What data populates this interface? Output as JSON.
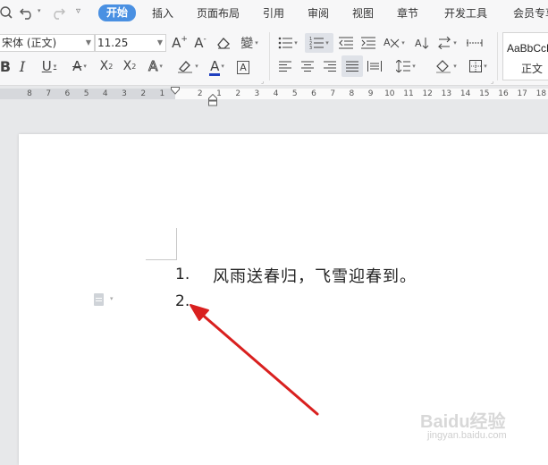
{
  "menubar": {
    "tabs": [
      "开始",
      "插入",
      "页面布局",
      "引用",
      "审阅",
      "视图",
      "章节",
      "开发工具",
      "会员专享"
    ],
    "active_tab": "开始"
  },
  "ribbon": {
    "font_name": "宋体 (正文)",
    "font_size": "11.25",
    "style_sample": "AaBbCcDd",
    "style_name": "正文"
  },
  "ruler": {
    "labels": [
      "8",
      "7",
      "6",
      "5",
      "4",
      "3",
      "2",
      "1",
      "",
      "2",
      "1",
      "2",
      "3",
      "4",
      "5",
      "6",
      "7",
      "8",
      "9",
      "10",
      "11",
      "12",
      "13",
      "14",
      "15",
      "16",
      "17",
      "18"
    ]
  },
  "document": {
    "list": [
      {
        "number": "1.",
        "text": "风雨送春归，飞雪迎春到。"
      },
      {
        "number": "2.",
        "text": ""
      }
    ]
  },
  "watermark": {
    "brand": "Baidu经验",
    "url": "jingyan.baidu.com"
  },
  "colors": {
    "accent": "#4a90e2",
    "arrow": "#d9201f",
    "font_color_bar": "#1f3fbf"
  }
}
